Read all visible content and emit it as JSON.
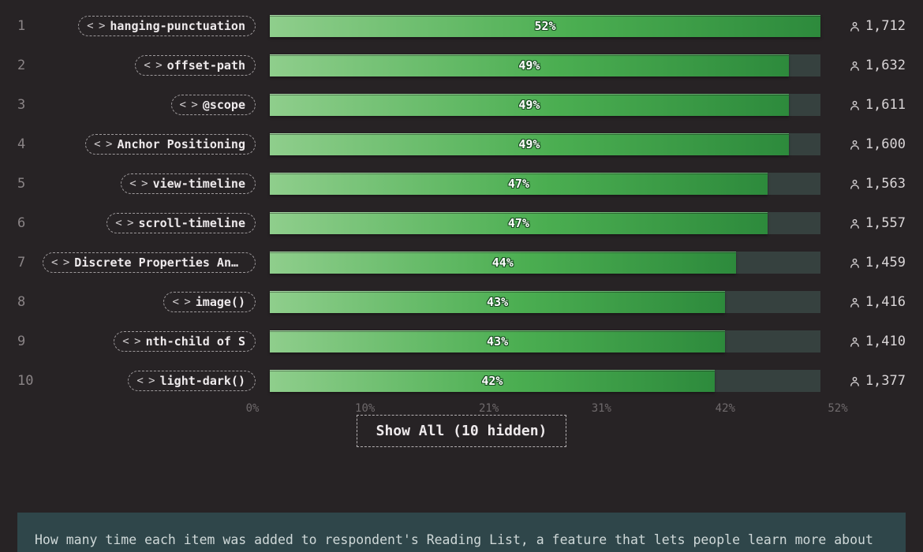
{
  "axis": {
    "ticks": [
      {
        "pos": 0,
        "label": "0%"
      },
      {
        "pos": 10,
        "label": "10%"
      },
      {
        "pos": 21,
        "label": "21%"
      },
      {
        "pos": 31,
        "label": "31%"
      },
      {
        "pos": 42,
        "label": "42%"
      },
      {
        "pos": 52,
        "label": "52%"
      }
    ],
    "max": 52
  },
  "show_all_label": "Show All (10 hidden)",
  "footer_text": "How many time each item was added to respondent's Reading List, a feature that lets people learn more about",
  "chart_data": {
    "type": "bar",
    "title": "",
    "xlabel": "",
    "ylabel": "",
    "ylim": [
      0,
      52
    ],
    "categories": [
      "hanging-punctuation",
      "offset-path",
      "@scope",
      "Anchor Positioning",
      "view-timeline",
      "scroll-timeline",
      "Discrete Properties Anima…",
      "image()",
      "nth-child of S",
      "light-dark()"
    ],
    "series": [
      {
        "name": "percent",
        "values": [
          52,
          49,
          49,
          49,
          47,
          47,
          44,
          43,
          43,
          42
        ]
      },
      {
        "name": "respondents",
        "values": [
          1712,
          1632,
          1611,
          1600,
          1563,
          1557,
          1459,
          1416,
          1410,
          1377
        ]
      }
    ]
  }
}
